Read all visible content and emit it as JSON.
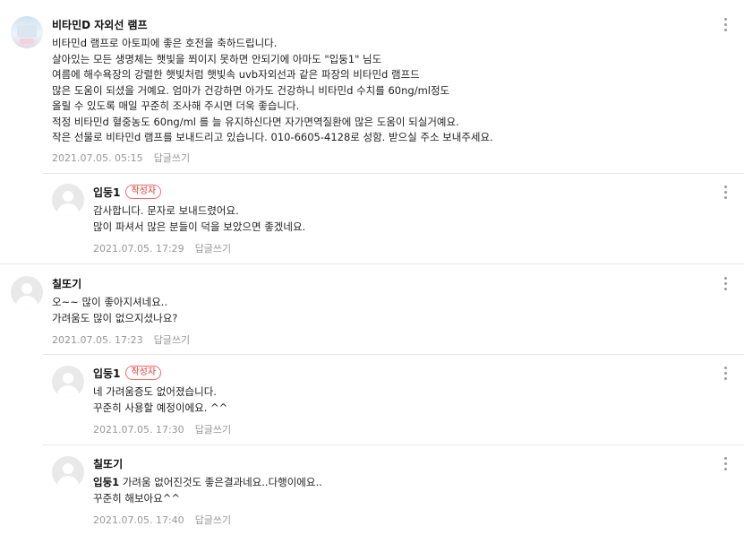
{
  "comments": [
    {
      "nick": "비타민D 자외선 램프",
      "badge": "",
      "lines": [
        "비타민d 램프로 아토피에 좋은 호전을 축하드립니다.",
        "살아있는 모든 생명체는 햇빛을 쬐이지 못하면 안되기에 아마도 \"입둥1\" 님도",
        "여름에 해수욕장의 강렬한 햇빛처럼 햇빛속 uvb자외선과 같은 파장의 비타민d 램프드",
        "많은 도움이 되셨을 거예요. 엄마가 건강하면 아가도 건강하니 비타민d 수치를 60ng/ml정도",
        "올릴 수 있도록 매일 꾸준히 조사해 주시면 더욱 좋습니다.",
        "적정 비타민d 혈중농도 60ng/ml 를 늘 유지하신다면 자가면역질환에 많은 도움이 되실거예요.",
        "작은 선물로 비타민d 램프를 보내드리고 있습니다. 010-6605-4128로 성함. 받으실 주소 보내주세요."
      ],
      "date": "2021.07.05. 05:15",
      "reply": "답글쓰기",
      "avatar": "photo"
    },
    {
      "nick": "입둥1",
      "badge": "작성자",
      "lines": [
        "감사합니다. 문자로 보내드렸어요.",
        "많이 파셔서 많은 분들이 덕을 보았으면 좋겠네요."
      ],
      "date": "2021.07.05. 17:29",
      "reply": "답글쓰기",
      "avatar": "default"
    },
    {
      "nick": "칠또기",
      "badge": "",
      "lines": [
        "오~~ 많이 좋아지셔네요..",
        "가려움도 많이 없으지셨나요?"
      ],
      "date": "2021.07.05. 17:23",
      "reply": "답글쓰기",
      "avatar": "default"
    },
    {
      "nick": "입둥1",
      "badge": "작성자",
      "lines": [
        "네 가려움증도 없어졌습니다.",
        "꾸준히 사용할 예정이에요. ^^"
      ],
      "date": "2021.07.05. 17:30",
      "reply": "답글쓰기",
      "avatar": "default"
    },
    {
      "nick": "칠또기",
      "badge": "",
      "mention": "입둥1",
      "lines": [
        "가려움 없어진것도 좋은결과네요..다행이에요..",
        "꾸준히 해보아요^^"
      ],
      "date": "2021.07.05. 17:40",
      "reply": "답글쓰기",
      "avatar": "default"
    }
  ],
  "colors": {
    "badge": "#ee3333",
    "meta": "#979797",
    "divider": "#e6e6e6"
  }
}
